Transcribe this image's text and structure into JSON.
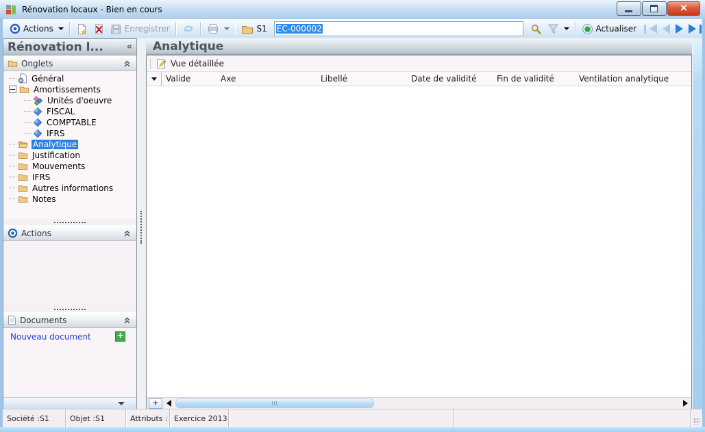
{
  "window": {
    "title": "Rénovation locaux -  Bien en cours"
  },
  "toolbar": {
    "actions": "Actions",
    "save": "Enregistrer",
    "folder": "S1",
    "record_field": {
      "value": "EC-000002"
    },
    "refresh": "Actualiser"
  },
  "left_panel": {
    "header": "Rénovation l...",
    "onglets": {
      "label": "Onglets"
    },
    "actions": {
      "label": "Actions"
    },
    "documents": {
      "label": "Documents",
      "new_doc": "Nouveau document"
    },
    "tree": [
      {
        "label": "Général",
        "icon": "page-gear",
        "level": 1
      },
      {
        "label": "Amortissements",
        "icon": "folder",
        "level": 1,
        "expander": true
      },
      {
        "label": "Unités d'oeuvre",
        "icon": "diamonds",
        "level": 2
      },
      {
        "label": "FISCAL",
        "icon": "diamond",
        "level": 2
      },
      {
        "label": "COMPTABLE",
        "icon": "diamond",
        "level": 2
      },
      {
        "label": "IFRS",
        "icon": "diamond",
        "level": 2
      },
      {
        "label": "Analytique",
        "icon": "folder-open",
        "level": 1,
        "selected": true
      },
      {
        "label": "Justification",
        "icon": "folder",
        "level": 1
      },
      {
        "label": "Mouvements",
        "icon": "folder",
        "level": 1
      },
      {
        "label": "IFRS",
        "icon": "folder",
        "level": 1
      },
      {
        "label": "Autres informations",
        "icon": "folder",
        "level": 1
      },
      {
        "label": "Notes",
        "icon": "folder",
        "level": 1
      }
    ]
  },
  "main": {
    "title": "Analytique",
    "detail_view": "Vue détaillée",
    "grid": {
      "columns": [
        "Valide",
        "Axe",
        "Libellé",
        "Date de validité",
        "Fin de validité",
        "Ventilation analytique"
      ],
      "rows": []
    }
  },
  "status": {
    "cells": [
      "Société :S1",
      "Objet :S1",
      "Attributs :",
      "Exercice 2013",
      "",
      ""
    ]
  },
  "colors": {
    "selection": "#2e80e0",
    "titlebar": "#c3dcf2",
    "close_button": "#c33a1f",
    "link": "#2244cc",
    "accent_green": "#3fae49",
    "folder": "#f0c987"
  }
}
